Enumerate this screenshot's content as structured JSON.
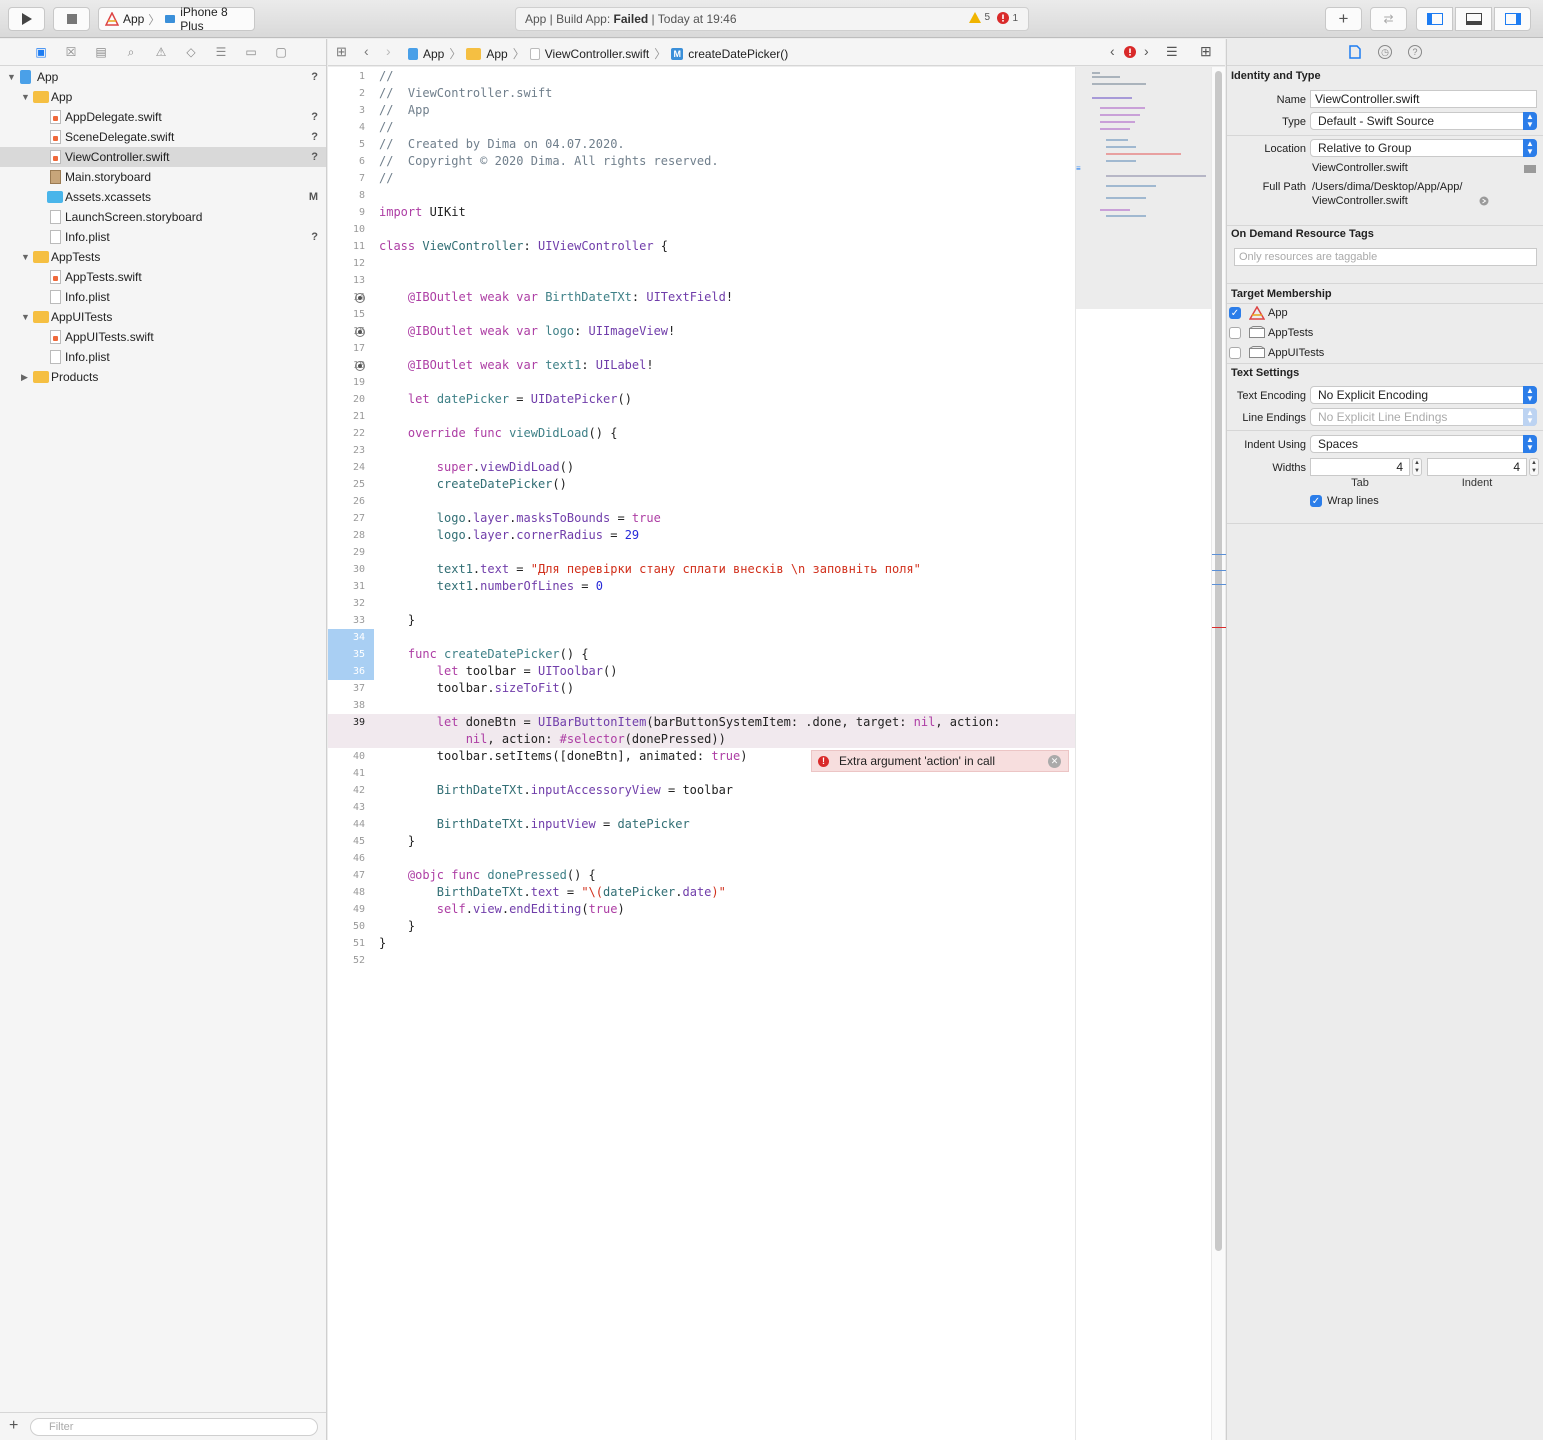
{
  "toolbar": {
    "scheme_app": "App",
    "scheme_device": "iPhone 8 Plus",
    "status_prefix": "App | Build App: ",
    "status_result": "Failed",
    "status_suffix": " | Today at 19:46",
    "warning_count": "5",
    "error_count": "1",
    "add_label": "+"
  },
  "navigator": {
    "tree": [
      {
        "label": "App",
        "badge": "?"
      },
      {
        "label": "App",
        "badge": ""
      },
      {
        "label": "AppDelegate.swift",
        "badge": "?"
      },
      {
        "label": "SceneDelegate.swift",
        "badge": "?"
      },
      {
        "label": "ViewController.swift",
        "badge": "?"
      },
      {
        "label": "Main.storyboard",
        "badge": ""
      },
      {
        "label": "Assets.xcassets",
        "badge": "M"
      },
      {
        "label": "LaunchScreen.storyboard",
        "badge": ""
      },
      {
        "label": "Info.plist",
        "badge": "?"
      },
      {
        "label": "AppTests",
        "badge": ""
      },
      {
        "label": "AppTests.swift",
        "badge": ""
      },
      {
        "label": "Info.plist",
        "badge": ""
      },
      {
        "label": "AppUITests",
        "badge": ""
      },
      {
        "label": "AppUITests.swift",
        "badge": ""
      },
      {
        "label": "Info.plist",
        "badge": ""
      },
      {
        "label": "Products",
        "badge": ""
      }
    ],
    "filter_placeholder": "Filter"
  },
  "jumpbar": {
    "crumbs": [
      "App",
      "App",
      "ViewController.swift",
      "createDatePicker()"
    ],
    "method_icon": "M"
  },
  "editor": {
    "line_numbers": [
      "1",
      "2",
      "3",
      "4",
      "5",
      "6",
      "7",
      "8",
      "9",
      "10",
      "11",
      "12",
      "13",
      "14",
      "15",
      "16",
      "17",
      "18",
      "19",
      "20",
      "21",
      "22",
      "23",
      "24",
      "25",
      "26",
      "27",
      "28",
      "29",
      "30",
      "31",
      "32",
      "33",
      "34",
      "35",
      "36",
      "37",
      "38",
      "39",
      "40",
      "41",
      "42",
      "43",
      "44",
      "45",
      "46",
      "47",
      "48",
      "49",
      "50",
      "51",
      "52"
    ],
    "error_message": "Extra argument 'action' in call"
  },
  "inspector": {
    "identity_title": "Identity and Type",
    "name_label": "Name",
    "name_value": "ViewController.swift",
    "type_label": "Type",
    "type_value": "Default - Swift Source",
    "location_label": "Location",
    "location_value": "Relative to Group",
    "location_file": "ViewController.swift",
    "fullpath_label": "Full Path",
    "fullpath_line1": "/Users/dima/Desktop/App/App/",
    "fullpath_line2": "ViewController.swift",
    "odr_title": "On Demand Resource Tags",
    "odr_placeholder": "Only resources are taggable",
    "target_title": "Target Membership",
    "targets": [
      {
        "name": "App",
        "checked": true
      },
      {
        "name": "AppTests",
        "checked": false
      },
      {
        "name": "AppUITests",
        "checked": false
      }
    ],
    "text_title": "Text Settings",
    "encoding_label": "Text Encoding",
    "encoding_value": "No Explicit Encoding",
    "endings_label": "Line Endings",
    "endings_value": "No Explicit Line Endings",
    "indent_label": "Indent Using",
    "indent_value": "Spaces",
    "widths_label": "Widths",
    "tab_value": "4",
    "indent_width_value": "4",
    "tab_caption": "Tab",
    "indent_caption": "Indent",
    "wrap_label": "Wrap lines"
  }
}
